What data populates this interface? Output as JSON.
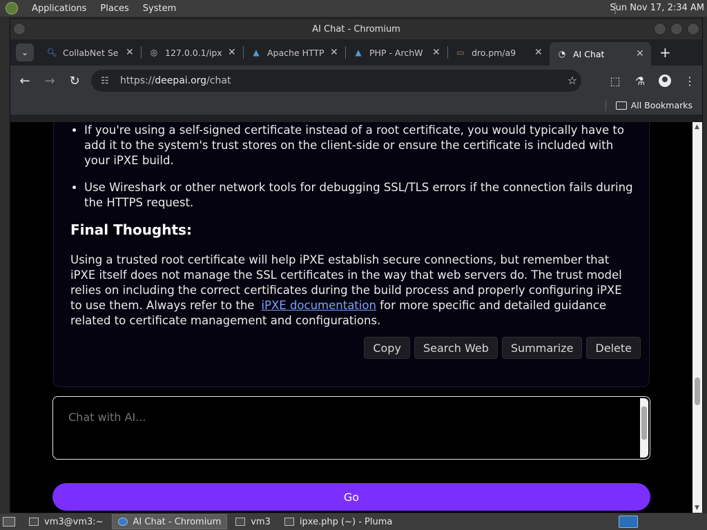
{
  "panel": {
    "menus": [
      "Applications",
      "Places",
      "System"
    ],
    "clock": "Sun Nov 17,  2:34 AM"
  },
  "window": {
    "title": "AI Chat - Chromium"
  },
  "tabs": [
    {
      "label": "CollabNet Se",
      "icon": "search-icon"
    },
    {
      "label": "127.0.0.1/ipx",
      "icon": "globe-icon"
    },
    {
      "label": "Apache HTTP",
      "icon": "arch-icon"
    },
    {
      "label": "PHP - ArchW",
      "icon": "arch-icon"
    },
    {
      "label": "dro.pm/a9",
      "icon": "folder-icon"
    },
    {
      "label": "AI Chat",
      "icon": "deepai-icon"
    }
  ],
  "address_bar": {
    "scheme": "https://",
    "host": "deepai.org",
    "path": "/chat"
  },
  "bookmarks": {
    "all_label": "All Bookmarks"
  },
  "message": {
    "bullets": [
      "If you're using a self-signed certificate instead of a root certificate, you would typically have to add it to the system's trust stores on the client-side or ensure the certificate is included with your iPXE build.",
      "Use Wireshark or other network tools for debugging SSL/TLS errors if the connection fails during the HTTPS request."
    ],
    "heading": "Final Thoughts:",
    "paragraph_before_link": "Using a trusted root certificate will help iPXE establish secure connections, but remember that iPXE itself does not manage the SSL certificates in the way that web servers do. The trust model relies on including the correct certificates during the build process and properly configuring iPXE to use them. Always refer to the",
    "link_text": "iPXE documentation",
    "paragraph_after_link": " for more specific and detailed guidance related to certificate management and configurations.",
    "actions": [
      "Copy",
      "Search Web",
      "Summarize",
      "Delete"
    ]
  },
  "chat_input": {
    "placeholder": "Chat with AI..."
  },
  "go_button": "Go",
  "taskbar": [
    {
      "label": "vm3@vm3:~",
      "active": false
    },
    {
      "label": "AI Chat - Chromium",
      "active": true
    },
    {
      "label": "vm3",
      "active": false
    },
    {
      "label": "ipxe.php (~) - Pluma",
      "active": false
    }
  ],
  "colors": {
    "accent": "#7b2fff",
    "link": "#7aa2ff",
    "page_bg": "#000000"
  }
}
